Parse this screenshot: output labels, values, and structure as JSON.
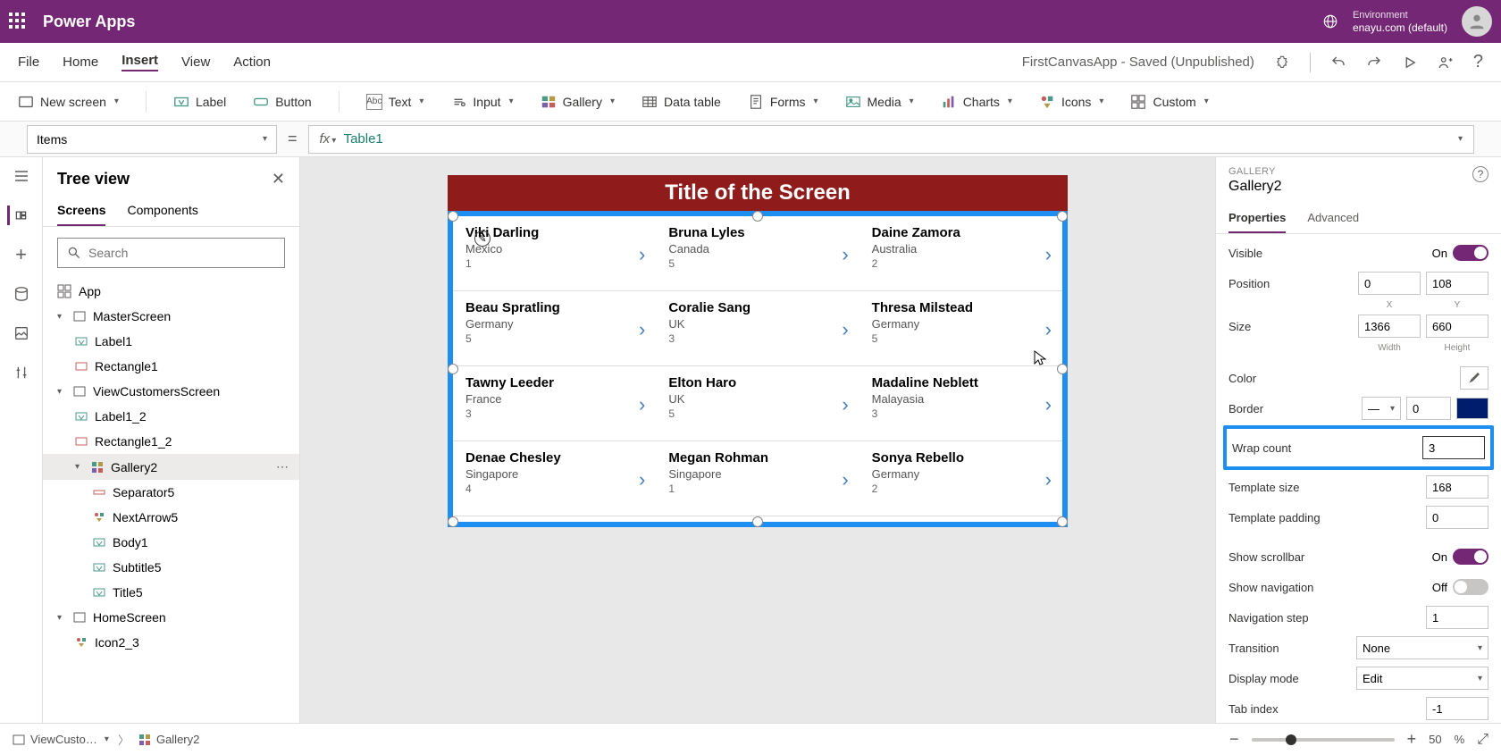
{
  "brand": "Power Apps",
  "env": {
    "label": "Environment",
    "value": "enayu.com (default)"
  },
  "menu": {
    "file": "File",
    "home": "Home",
    "insert": "Insert",
    "view": "View",
    "action": "Action"
  },
  "doc_title": "FirstCanvasApp - Saved (Unpublished)",
  "ribbon": {
    "new_screen": "New screen",
    "label": "Label",
    "button": "Button",
    "text": "Text",
    "input": "Input",
    "gallery": "Gallery",
    "data_table": "Data table",
    "forms": "Forms",
    "media": "Media",
    "charts": "Charts",
    "icons": "Icons",
    "custom": "Custom"
  },
  "formula": {
    "property": "Items",
    "fx": "fx",
    "value": "Table1"
  },
  "tree": {
    "title": "Tree view",
    "tabs": {
      "screens": "Screens",
      "components": "Components"
    },
    "search_ph": "Search",
    "app": "App",
    "nodes": {
      "master": "MasterScreen",
      "label1": "Label1",
      "rect1": "Rectangle1",
      "viewcust": "ViewCustomersScreen",
      "label1_2": "Label1_2",
      "rect1_2": "Rectangle1_2",
      "gallery2": "Gallery2",
      "sep5": "Separator5",
      "next5": "NextArrow5",
      "body1": "Body1",
      "subtitle5": "Subtitle5",
      "title5": "Title5",
      "home": "HomeScreen",
      "icon2_3": "Icon2_3"
    }
  },
  "canvas": {
    "screen_title": "Title of the Screen",
    "cells": [
      {
        "name": "Viki Darling",
        "sub": "Mexico",
        "num": "1"
      },
      {
        "name": "Bruna Lyles",
        "sub": "Canada",
        "num": "5"
      },
      {
        "name": "Daine Zamora",
        "sub": "Australia",
        "num": "2"
      },
      {
        "name": "Beau Spratling",
        "sub": "Germany",
        "num": "5"
      },
      {
        "name": "Coralie Sang",
        "sub": "UK",
        "num": "3"
      },
      {
        "name": "Thresa Milstead",
        "sub": "Germany",
        "num": "5"
      },
      {
        "name": "Tawny Leeder",
        "sub": "France",
        "num": "3"
      },
      {
        "name": "Elton Haro",
        "sub": "UK",
        "num": "5"
      },
      {
        "name": "Madaline Neblett",
        "sub": "Malayasia",
        "num": "3"
      },
      {
        "name": "Denae Chesley",
        "sub": "Singapore",
        "num": "4"
      },
      {
        "name": "Megan Rohman",
        "sub": "Singapore",
        "num": "1"
      },
      {
        "name": "Sonya Rebello",
        "sub": "Germany",
        "num": "2"
      }
    ]
  },
  "props": {
    "category": "GALLERY",
    "name": "Gallery2",
    "tabs": {
      "properties": "Properties",
      "advanced": "Advanced"
    },
    "visible": {
      "lbl": "Visible",
      "on": "On"
    },
    "position": {
      "lbl": "Position",
      "x": "0",
      "y": "108",
      "xl": "X",
      "yl": "Y"
    },
    "size": {
      "lbl": "Size",
      "w": "1366",
      "h": "660",
      "wl": "Width",
      "hl": "Height"
    },
    "color": "Color",
    "border": {
      "lbl": "Border",
      "val": "0"
    },
    "wrap": {
      "lbl": "Wrap count",
      "val": "3"
    },
    "tpl_size": {
      "lbl": "Template size",
      "val": "168"
    },
    "tpl_pad": {
      "lbl": "Template padding",
      "val": "0"
    },
    "scrollbar": {
      "lbl": "Show scrollbar",
      "on": "On"
    },
    "nav": {
      "lbl": "Show navigation",
      "off": "Off"
    },
    "nav_step": {
      "lbl": "Navigation step",
      "val": "1"
    },
    "transition": {
      "lbl": "Transition",
      "val": "None"
    },
    "display_mode": {
      "lbl": "Display mode",
      "val": "Edit"
    },
    "tab_index": {
      "lbl": "Tab index",
      "val": "-1"
    }
  },
  "status": {
    "screen": "ViewCusto…",
    "crumb": "Gallery2",
    "zoom": "50",
    "pct": "%"
  }
}
